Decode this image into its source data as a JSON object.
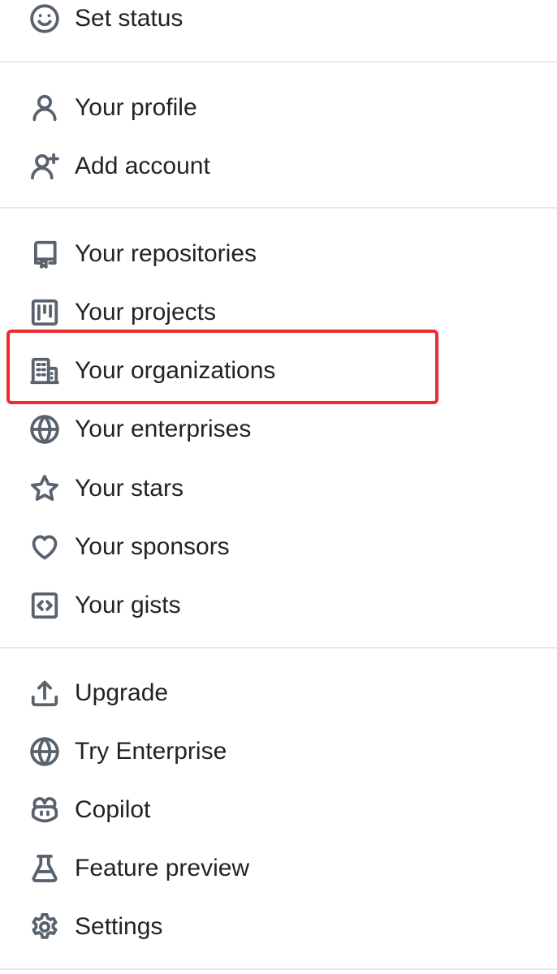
{
  "menu": {
    "set_status": {
      "label": "Set status",
      "icon": "smiley-icon"
    },
    "your_profile": {
      "label": "Your profile",
      "icon": "person-icon"
    },
    "add_account": {
      "label": "Add account",
      "icon": "person-add-icon"
    },
    "your_repositories": {
      "label": "Your repositories",
      "icon": "repo-icon"
    },
    "your_projects": {
      "label": "Your projects",
      "icon": "project-icon"
    },
    "your_organizations": {
      "label": "Your organizations",
      "icon": "organization-icon"
    },
    "your_enterprises": {
      "label": "Your enterprises",
      "icon": "globe-icon"
    },
    "your_stars": {
      "label": "Your stars",
      "icon": "star-icon"
    },
    "your_sponsors": {
      "label": "Your sponsors",
      "icon": "heart-icon"
    },
    "your_gists": {
      "label": "Your gists",
      "icon": "code-square-icon"
    },
    "upgrade": {
      "label": "Upgrade",
      "icon": "upload-icon"
    },
    "try_enterprise": {
      "label": "Try Enterprise",
      "icon": "globe-icon"
    },
    "copilot": {
      "label": "Copilot",
      "icon": "copilot-icon"
    },
    "feature_preview": {
      "label": "Feature preview",
      "icon": "beaker-icon"
    },
    "settings": {
      "label": "Settings",
      "icon": "gear-icon"
    }
  },
  "highlighted_item": "your_organizations",
  "colors": {
    "text": "#1f2328",
    "icon": "#59636e",
    "divider": "#e5e7ea",
    "highlight_border": "#ee2a2a"
  }
}
